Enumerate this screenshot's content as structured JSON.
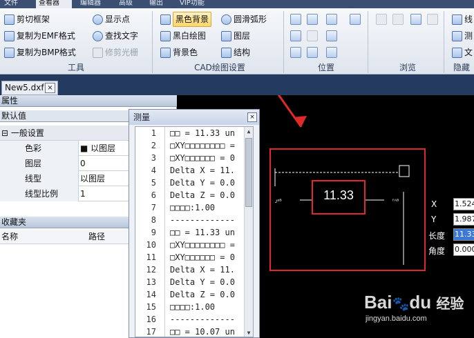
{
  "top_tabs": [
    "文件",
    "查看器",
    "编辑器",
    "高级",
    "输出",
    "VIP功能"
  ],
  "ribbon": {
    "tools": {
      "buttons": [
        "剪切框架",
        "复制为EMF格式",
        "复制为BMP格式"
      ],
      "buttons2": [
        "显示点",
        "查找文字",
        "修剪光栅"
      ],
      "label": "工具"
    },
    "cad": {
      "col1": [
        "黑色背景",
        "黑白绘图",
        "背景色"
      ],
      "col2": [
        "圆滑弧形",
        "图层",
        "结构"
      ],
      "label": "CAD绘图设置"
    },
    "position": {
      "label": "位置"
    },
    "browse": {
      "label": "浏览"
    },
    "hidden": {
      "buttons": [
        "线",
        "测",
        "文"
      ],
      "label": "隐藏"
    }
  },
  "doc_tab": {
    "label": "New5.dxf",
    "close": "×"
  },
  "properties": {
    "header": "属性",
    "default_row": "默认值",
    "group": "⊟ 一般设置",
    "rows": [
      {
        "key": "色彩",
        "value": "■ 以图层"
      },
      {
        "key": "图层",
        "value": "0"
      },
      {
        "key": "线型",
        "value": "以图层"
      },
      {
        "key": "线型比例",
        "value": "1"
      }
    ],
    "favorites_header": "收藏夹",
    "fav_cols": [
      "名称",
      "路径"
    ]
  },
  "measure": {
    "title": "测量",
    "close": "×",
    "lines": [
      {
        "n": "1",
        "t": "□□ = 11.33 un"
      },
      {
        "n": "2",
        "t": "□XY□□□□□□□□ ="
      },
      {
        "n": "3",
        "t": "□XY□□□□□□ = 0"
      },
      {
        "n": "4",
        "t": "Delta X = 11."
      },
      {
        "n": "5",
        "t": "Delta Y = 0.0"
      },
      {
        "n": "6",
        "t": "Delta Z = 0.0"
      },
      {
        "n": "7",
        "t": "□□□□:1.00"
      },
      {
        "n": "8",
        "t": "-------------"
      },
      {
        "n": "9",
        "t": "□□ = 11.33 un"
      },
      {
        "n": "10",
        "t": "□XY□□□□□□□□ ="
      },
      {
        "n": "11",
        "t": "□XY□□□□□□ = 0"
      },
      {
        "n": "12",
        "t": "Delta X = 11."
      },
      {
        "n": "13",
        "t": "Delta Y = 0.0"
      },
      {
        "n": "14",
        "t": "Delta Z = 0.0"
      },
      {
        "n": "15",
        "t": "□□□□:1.00"
      },
      {
        "n": "16",
        "t": "-------------"
      },
      {
        "n": "17",
        "t": "□□ = 10.07 un"
      }
    ]
  },
  "canvas": {
    "dimension_value": "11.33",
    "left_label": "ᴊᵃᴮ",
    "right_label": "ᶠᴬᴮ",
    "coords": [
      {
        "label": "X",
        "value": "1.524"
      },
      {
        "label": "Y",
        "value": "1.987"
      },
      {
        "label": "长度",
        "value": "11.33"
      },
      {
        "label": "角度",
        "value": "0.000"
      }
    ]
  },
  "watermark": {
    "brand": "Bai",
    "paw": "du",
    "cn": "经验",
    "url": "jingyan.baidu.com"
  },
  "colors": {
    "annotation_red": "#e02a2a",
    "ribbon_dark": "#243a5f",
    "selection_blue": "#3b78d8"
  }
}
